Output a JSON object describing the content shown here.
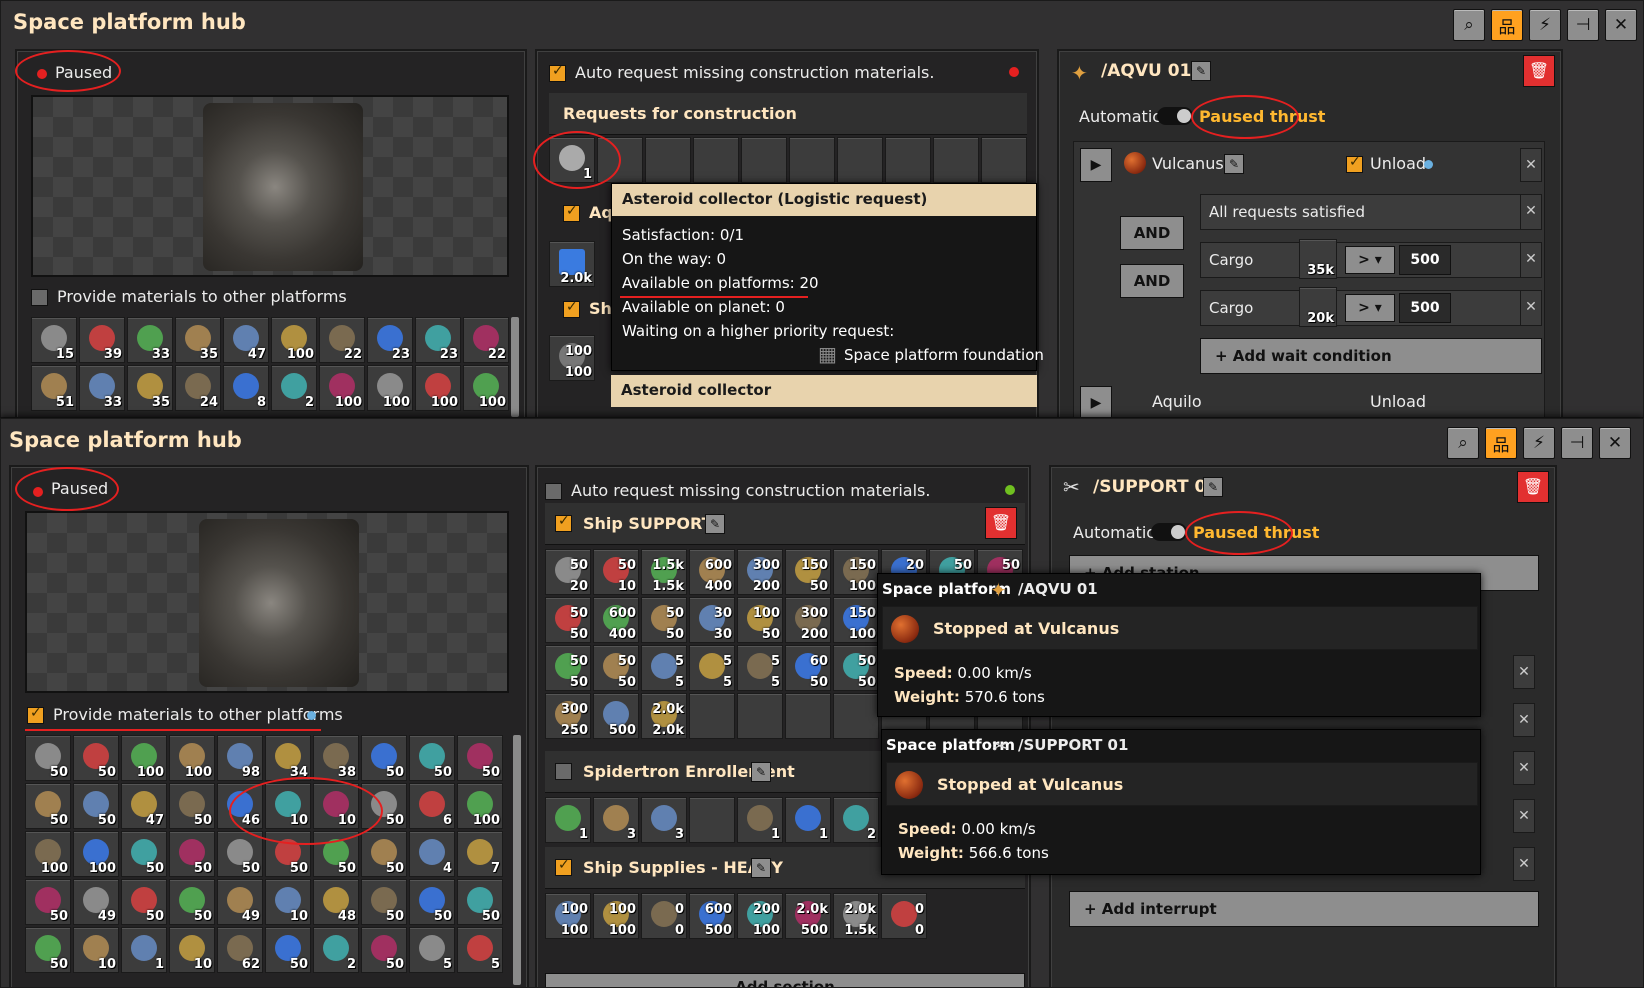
{
  "window_top": {
    "title": "Space platform hub",
    "status": "Paused",
    "provide_label": "Provide materials to other platforms",
    "inventory": [
      [
        "15",
        "39",
        "33",
        "35",
        "47",
        "100",
        "22",
        "23",
        "23",
        "22"
      ],
      [
        "51",
        "33",
        "35",
        "24",
        "8",
        "2",
        "100",
        "100",
        "100",
        "100"
      ]
    ],
    "auto_request_label": "Auto request missing construction materials.",
    "requests_header": "Requests for construction",
    "request_slot_count": "1",
    "section_partial_1": "Aqu",
    "section_partial_2": "Shi",
    "partial_counts": [
      "2.0k",
      "100",
      "100"
    ],
    "tooltip": {
      "title": "Asteroid collector (Logistic request)",
      "satisfaction": "Satisfaction: 0/1",
      "on_the_way": "On the way: 0",
      "available_platforms": "Available on platforms: 20",
      "available_planet": "Available on planet: 0",
      "waiting": "Waiting on a higher priority request:",
      "waiting_item": "Space platform foundation",
      "next_title": "Asteroid collector"
    },
    "schedule": {
      "name": "/AQVU 01",
      "automatic": "Automatic",
      "paused_thrust": "Paused thrust",
      "station": "Vulcanus",
      "unload": "Unload",
      "cond_all": "All requests satisfied",
      "cond_and": "AND",
      "cargo": "Cargo",
      "cargo1_count": "35k",
      "cargo2_count": "20k",
      "op": ">",
      "value": "500",
      "add_wait": "+ Add wait condition",
      "next_station": "Aquilo",
      "next_unload": "Unload"
    }
  },
  "window_bottom": {
    "title": "Space platform hub",
    "status": "Paused",
    "provide_label": "Provide materials to other platforms",
    "inventory": [
      [
        "50",
        "50",
        "100",
        "100",
        "98",
        "34",
        "38",
        "50",
        "50",
        "50"
      ],
      [
        "50",
        "50",
        "47",
        "50",
        "46",
        "10",
        "10",
        "50",
        "6",
        "100"
      ],
      [
        "100",
        "100",
        "50",
        "50",
        "50",
        "50",
        "50",
        "50",
        "4",
        "7"
      ],
      [
        "50",
        "49",
        "50",
        "50",
        "49",
        "10",
        "48",
        "50",
        "50",
        "50"
      ],
      [
        "50",
        "10",
        "1",
        "10",
        "62",
        "50",
        "2",
        "50",
        "5",
        "5"
      ]
    ],
    "auto_request_label": "Auto request missing construction materials.",
    "sections": [
      {
        "name": "Ship SUPPORT",
        "rows": [
          [
            [
              "50",
              "20"
            ],
            [
              "50",
              "10"
            ],
            [
              "1.5k",
              "1.5k"
            ],
            [
              "600",
              "400"
            ],
            [
              "300",
              "200"
            ],
            [
              "150",
              "50"
            ],
            [
              "150",
              "100"
            ],
            [
              "20",
              "10"
            ],
            [
              "50",
              "50"
            ],
            [
              "50",
              "50"
            ]
          ],
          [
            [
              "50",
              "50"
            ],
            [
              "600",
              "400"
            ],
            [
              "50",
              "50"
            ],
            [
              "30",
              "30"
            ],
            [
              "100",
              "50"
            ],
            [
              "300",
              "200"
            ],
            [
              "150",
              "100"
            ],
            [
              "",
              ""
            ],
            [
              "",
              ""
            ],
            [
              "",
              ""
            ]
          ],
          [
            [
              "50",
              "50"
            ],
            [
              "50",
              "50"
            ],
            [
              "5",
              "5"
            ],
            [
              "5",
              "5"
            ],
            [
              "5",
              "5"
            ],
            [
              "60",
              "50"
            ],
            [
              "50",
              "50"
            ],
            [
              "",
              ""
            ],
            [
              "",
              ""
            ],
            [
              "",
              ""
            ]
          ],
          [
            [
              "300",
              "250"
            ],
            [
              "",
              "500"
            ],
            [
              "2.0k",
              "2.0k"
            ],
            [
              "",
              ""
            ],
            [
              "",
              ""
            ],
            [
              "",
              ""
            ],
            [
              "",
              ""
            ],
            [
              "",
              ""
            ],
            [
              "",
              ""
            ],
            [
              "",
              ""
            ]
          ]
        ]
      },
      {
        "name": "Spidertron Enrollement",
        "rows": [
          [
            [
              "",
              "1"
            ],
            [
              "",
              "3"
            ],
            [
              "",
              "3"
            ],
            [
              "",
              ""
            ],
            [
              "",
              "1"
            ],
            [
              "",
              "1"
            ],
            [
              "",
              "2"
            ]
          ]
        ]
      },
      {
        "name": "Ship Supplies - HEAVY",
        "rows": [
          [
            [
              "100",
              "100"
            ],
            [
              "100",
              "100"
            ],
            [
              "0",
              "0"
            ],
            [
              "600",
              "500"
            ],
            [
              "200",
              "100"
            ],
            [
              "2.0k",
              "500"
            ],
            [
              "2.0k",
              "1.5k"
            ],
            [
              "0",
              "0"
            ]
          ]
        ]
      }
    ],
    "add_section": "Add section",
    "schedule": {
      "name": "/SUPPORT 01",
      "automatic": "Automatic",
      "paused_thrust": "Paused thrust",
      "add_station": "+ Add station",
      "add_interrupt": "+ Add interrupt"
    },
    "popups": [
      {
        "prefix": "Space platform",
        "name": "/AQVU 01",
        "status": "Stopped at Vulcanus",
        "speed_label": "Speed:",
        "speed": "0.00 km/s",
        "weight_label": "Weight:",
        "weight": "570.6 tons"
      },
      {
        "prefix": "Space platform",
        "name": "/SUPPORT 01",
        "status": "Stopped at Vulcanus",
        "speed_label": "Speed:",
        "speed": "0.00 km/s",
        "weight_label": "Weight:",
        "weight": "566.6 tons"
      }
    ]
  },
  "icons": [
    "search-icon",
    "network-icon",
    "lightning-icon",
    "pin-icon",
    "close-icon",
    "trash-icon",
    "edit-icon",
    "play-icon",
    "info-icon"
  ],
  "colors": {
    "accent": "#ffa120",
    "title": "#ffe6c0",
    "danger": "#e23030",
    "annotation": "#e52020"
  }
}
